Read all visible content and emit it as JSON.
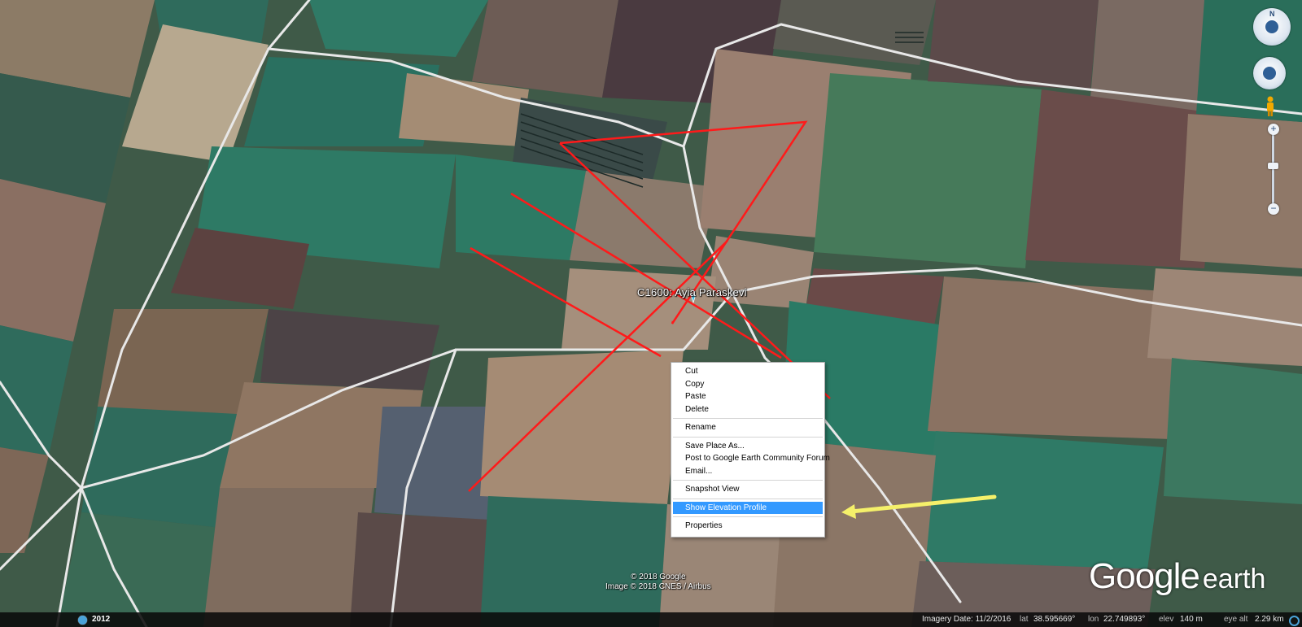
{
  "placemark": {
    "label": "C1600: Ayia Paraskevi"
  },
  "context_menu": {
    "items": [
      {
        "label": "Cut"
      },
      {
        "label": "Copy"
      },
      {
        "label": "Paste"
      },
      {
        "label": "Delete"
      },
      {
        "label": "Rename"
      },
      {
        "label": "Save Place As..."
      },
      {
        "label": "Post to Google Earth Community Forum"
      },
      {
        "label": "Email..."
      },
      {
        "label": "Snapshot View"
      },
      {
        "label": "Show Elevation Profile",
        "highlighted": true
      },
      {
        "label": "Properties"
      }
    ]
  },
  "navigation": {
    "look_label": "N",
    "zoom_in": "+",
    "zoom_out": "−"
  },
  "attribution": {
    "line1": "© 2018 Google",
    "line2": "Image © 2018 CNES / Airbus"
  },
  "logo": {
    "google": "Google",
    "earth": "earth"
  },
  "status": {
    "year": "2012",
    "imagery_date": "Imagery Date: 11/2/2016",
    "lat_label": "lat",
    "lat_value": "38.595669°",
    "lon_label": "lon",
    "lon_value": "22.749893°",
    "elev_label": "elev",
    "elev_value": "140 m",
    "eye_label": "eye alt",
    "eye_value": "2.29 km"
  },
  "colors": {
    "route_lines": "#ff1a1a",
    "arrow": "#f5f06a",
    "highlight": "#3399ff"
  },
  "icons": [
    "look-compass-icon",
    "move-joystick-icon",
    "pegman-icon",
    "zoom-in-icon",
    "zoom-out-icon",
    "historical-imagery-icon",
    "loading-icon",
    "pin-icon"
  ]
}
